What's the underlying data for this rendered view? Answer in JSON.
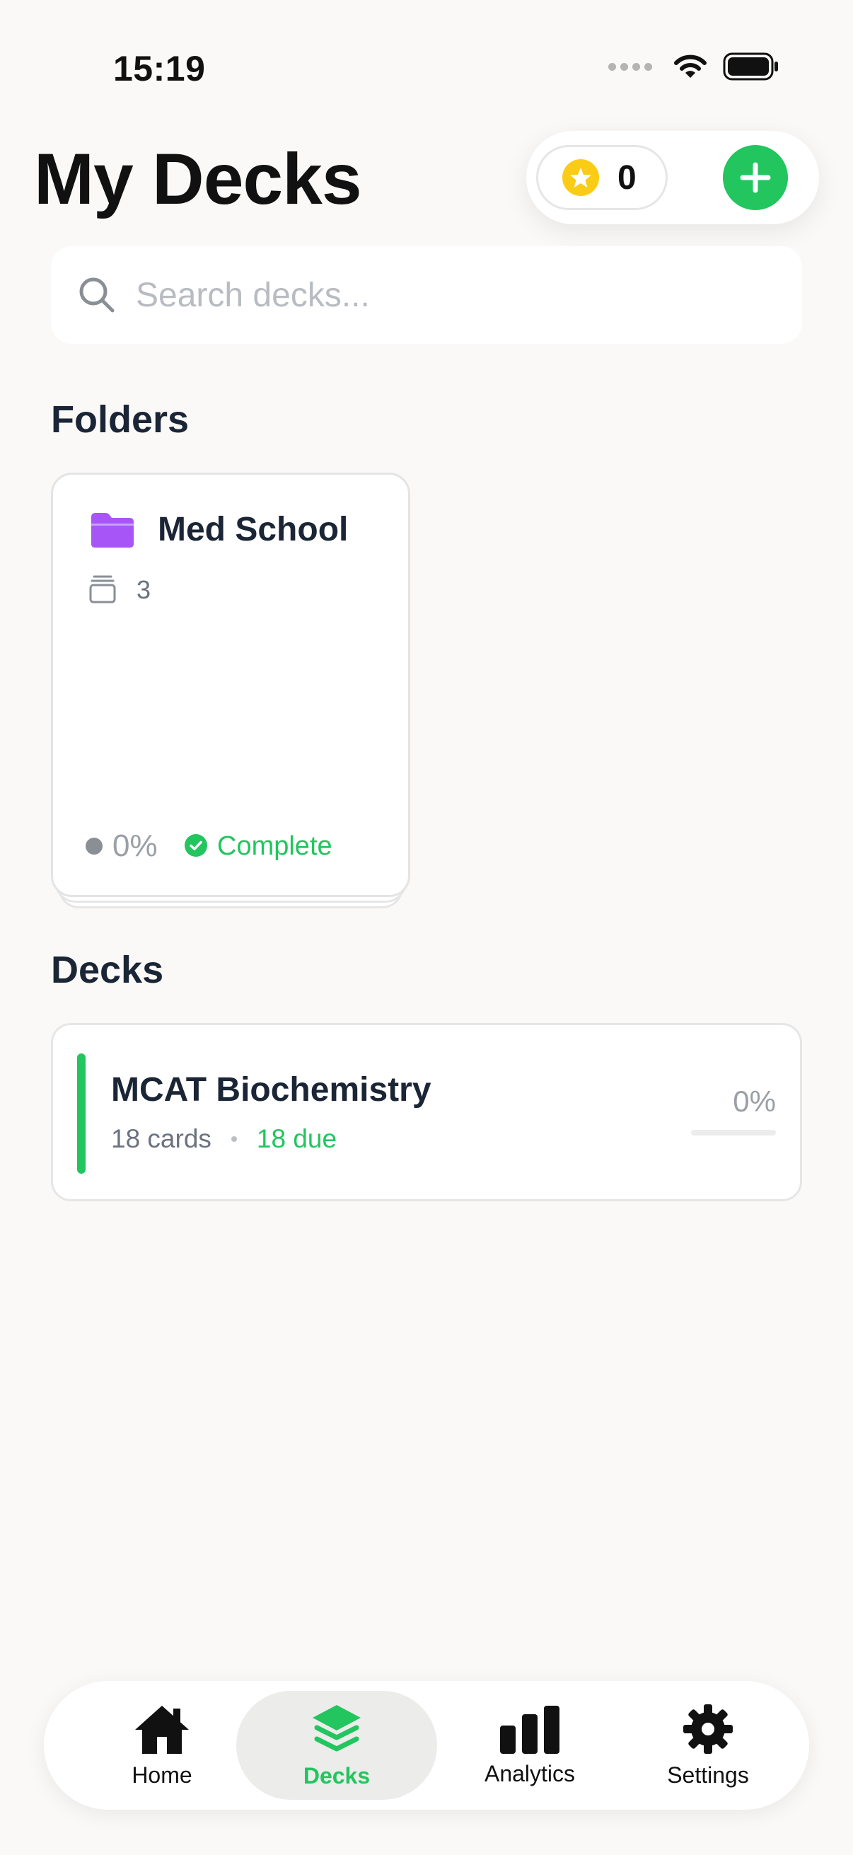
{
  "status_bar": {
    "time": "15:19"
  },
  "header": {
    "title": "My Decks",
    "coin_count": "0"
  },
  "search": {
    "placeholder": "Search decks..."
  },
  "folders_section": {
    "heading": "Folders",
    "items": [
      {
        "name": "Med School",
        "deck_count": "3",
        "progress": "0%",
        "status": "Complete"
      }
    ]
  },
  "decks_section": {
    "heading": "Decks",
    "items": [
      {
        "name": "MCAT Biochemistry",
        "cards": "18 cards",
        "due": "18 due",
        "progress": "0%",
        "progress_value": 0
      }
    ]
  },
  "tab_bar": {
    "tabs": [
      {
        "label": "Home",
        "icon": "home-icon",
        "active": false
      },
      {
        "label": "Decks",
        "icon": "layers-icon",
        "active": true
      },
      {
        "label": "Analytics",
        "icon": "bar-chart-icon",
        "active": false
      },
      {
        "label": "Settings",
        "icon": "gear-icon",
        "active": false
      }
    ]
  },
  "colors": {
    "accent": "#22c55e",
    "folder": "#a855f7",
    "coin": "#facc15",
    "background": "#faf9f7",
    "text_primary": "#1a2536",
    "text_secondary": "#6b7280"
  }
}
